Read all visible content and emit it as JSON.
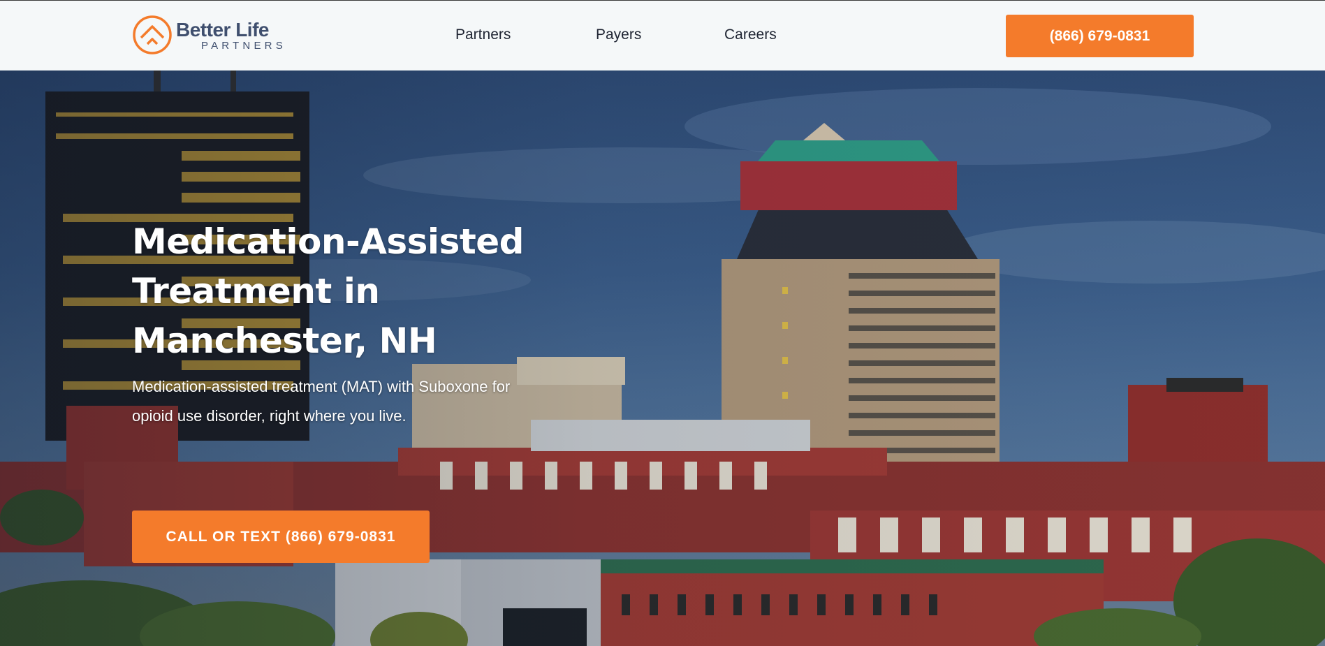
{
  "header": {
    "logo": {
      "name": "Better Life",
      "tagline": "PARTNERS"
    },
    "nav": [
      {
        "label": "Partners"
      },
      {
        "label": "Payers"
      },
      {
        "label": "Careers"
      }
    ],
    "phone_button": "(866) 679-0831"
  },
  "hero": {
    "title": "Medication-Assisted Treatment in Manchester, NH",
    "subtitle": "Medication-assisted treatment (MAT) with Suboxone for opioid use disorder, right where you live.",
    "cta": "CALL OR TEXT (866) 679-0831",
    "background": "Manchester, NH city skyline photo"
  },
  "colors": {
    "accent": "#f47b2b",
    "header_bg": "#f5f8f9",
    "logo_text": "#3f4f6e",
    "nav_text": "#1f2533"
  },
  "icons": {
    "logo_mark": "house-arrow-circle-icon"
  }
}
